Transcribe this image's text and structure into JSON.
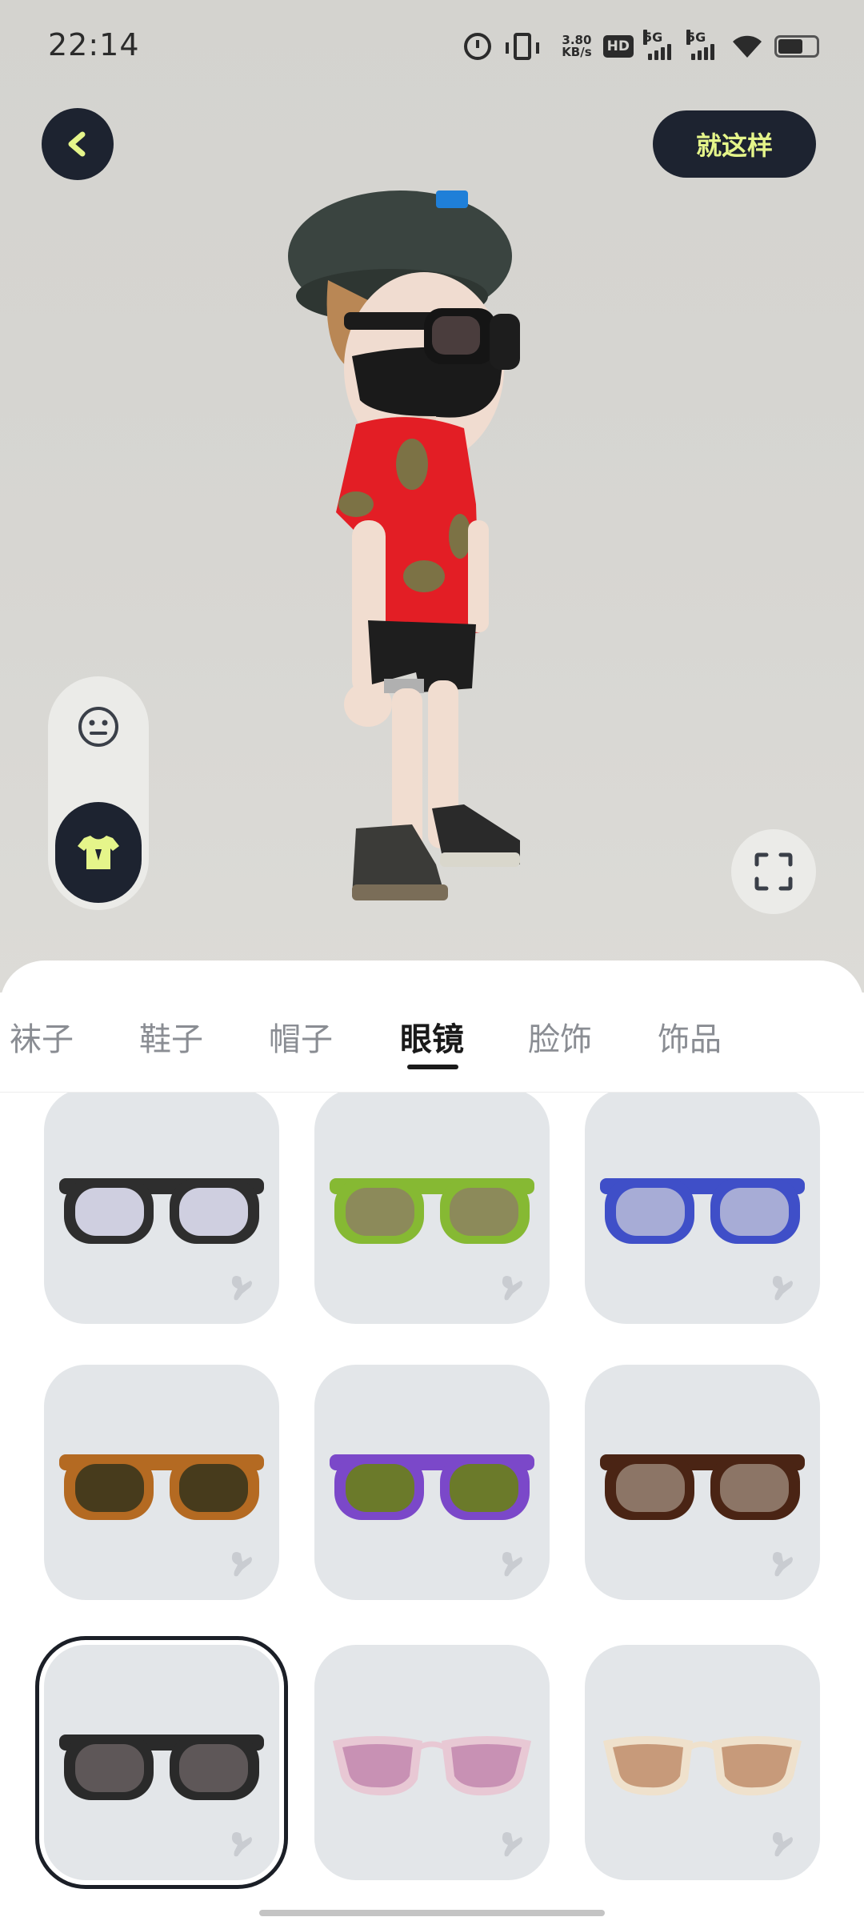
{
  "status_bar": {
    "time": "22:14",
    "net_speed_value": "3.80",
    "net_speed_unit": "KB/s",
    "hd_label": "HD",
    "signal_1_label": "5G",
    "signal_2_label": "5G"
  },
  "header": {
    "back_icon": "chevron-left-icon",
    "done_label": "就这样"
  },
  "side_controls": {
    "face_icon": "face-icon",
    "outfit_icon": "tshirt-icon",
    "fullscreen_icon": "fullscreen-icon"
  },
  "categories": {
    "tabs": [
      "袜子",
      "鞋子",
      "帽子",
      "眼镜",
      "脸饰",
      "饰品"
    ],
    "active": "眼镜"
  },
  "items": [
    {
      "frame": "#2e2e2e",
      "lens": "#cfcfe0",
      "style": "round",
      "selected": false
    },
    {
      "frame": "#86b933",
      "lens": "#8c8a5a",
      "style": "round",
      "selected": false
    },
    {
      "frame": "#3f4fc8",
      "lens": "#a7acd6",
      "style": "round",
      "selected": false
    },
    {
      "frame": "#b46a22",
      "lens": "#473b1c",
      "style": "round",
      "selected": false
    },
    {
      "frame": "#7b48c9",
      "lens": "#6b7a2a",
      "style": "round",
      "selected": false
    },
    {
      "frame": "#4a2414",
      "lens": "#8c7566",
      "style": "round",
      "selected": false
    },
    {
      "frame": "#2a2a2a",
      "lens": "#5e5758",
      "style": "round",
      "selected": true
    },
    {
      "frame": "#e8c8d4",
      "lens": "#c891b4",
      "style": "cat",
      "selected": false
    },
    {
      "frame": "#efe1cc",
      "lens": "#c79a7a",
      "style": "cat",
      "selected": false
    }
  ],
  "colors": {
    "dark": "#1d2330",
    "accent": "#e5f58a",
    "card_bg": "#e3e6e9"
  }
}
